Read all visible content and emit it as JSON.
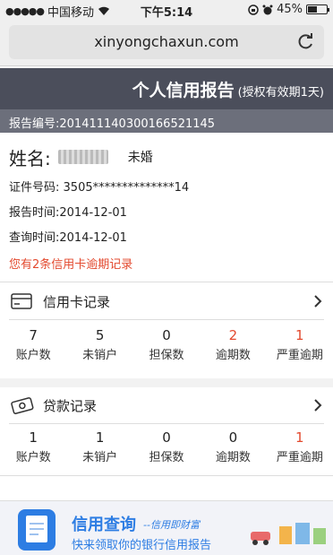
{
  "status_bar": {
    "carrier": "中国移动",
    "time": "下午5:14",
    "battery": "45%"
  },
  "browser": {
    "url": "xinyongchaxun.com"
  },
  "header": {
    "title": "个人信用报告",
    "validity": "(授权有效期1天)",
    "report_no": "报告编号:2014111403001665211​45"
  },
  "person": {
    "name_label": "姓名:",
    "marital": "未婚",
    "id_label": "证件号码:",
    "id_value": "3505**************14",
    "report_time": "报告时间:2014-12-01",
    "query_time": "查询时间:2014-12-01",
    "overdue_note": "您有2条信用卡逾期记录"
  },
  "credit_card": {
    "title": "信用卡记录",
    "stats": [
      {
        "value": "7",
        "label": "账户数"
      },
      {
        "value": "5",
        "label": "未销户"
      },
      {
        "value": "0",
        "label": "担保数"
      },
      {
        "value": "2",
        "label": "逾期数"
      },
      {
        "value": "1",
        "label": "严重逾期"
      }
    ]
  },
  "loan": {
    "title": "贷款记录",
    "stats": [
      {
        "value": "1",
        "label": "账户数"
      },
      {
        "value": "1",
        "label": "未销户"
      },
      {
        "value": "0",
        "label": "担保数"
      },
      {
        "value": "0",
        "label": "逾期数"
      },
      {
        "value": "1",
        "label": "严重逾期"
      }
    ]
  },
  "ad": {
    "title": "信用查询",
    "slogan": "--信用即财富",
    "subtitle": "快来领取你的银行信用报告"
  },
  "colors": {
    "header_bg": "#4b4e5b",
    "report_no_bg": "#6c6f7b",
    "alert": "#e34a2f",
    "brand_blue": "#2d7de3"
  }
}
